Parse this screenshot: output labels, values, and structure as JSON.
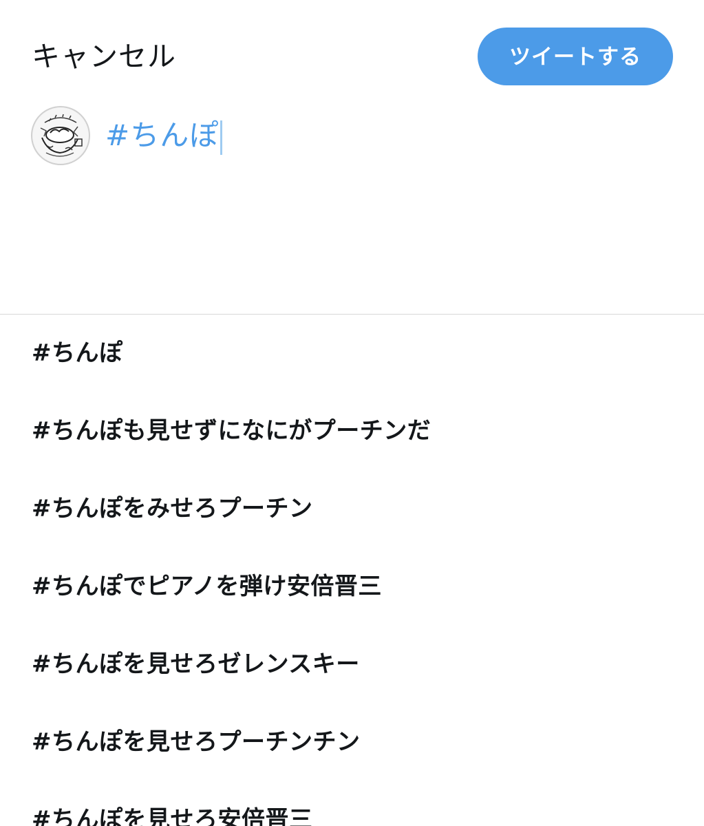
{
  "header": {
    "cancel_label": "キャンセル",
    "tweet_label": "ツイートする"
  },
  "composer": {
    "text": "#ちんぽ",
    "avatar_icon": "avatar-illustration-icon"
  },
  "suggestions": [
    "#ちんぽ",
    "#ちんぽも見せずになにがプーチンだ",
    "#ちんぽをみせろプーチン",
    "#ちんぽでピアノを弾け安倍晋三",
    "#ちんぽを見せろゼレンスキー",
    "#ちんぽを見せろプーチンチン",
    "#ちんぽを見せろ安倍晋三"
  ],
  "colors": {
    "accent": "#4c9be8",
    "text": "#14171a",
    "divider": "#d8d8d8"
  }
}
